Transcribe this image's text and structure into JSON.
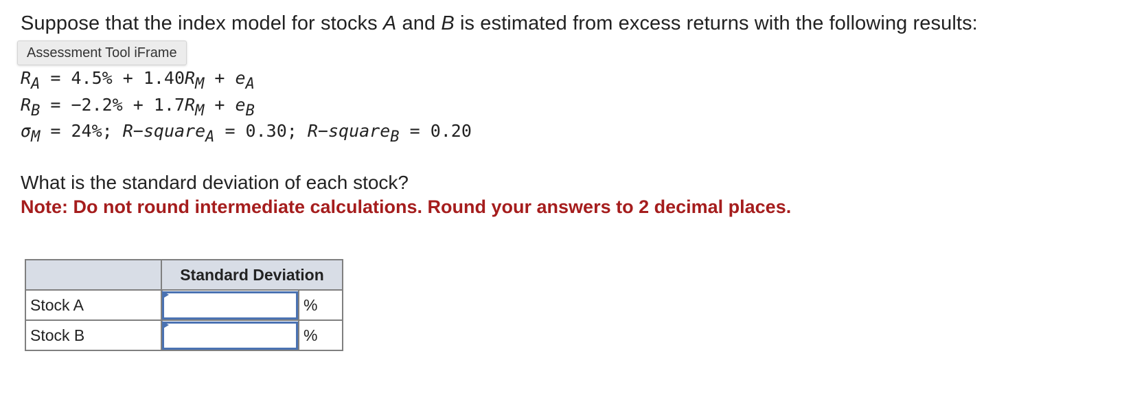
{
  "intro": {
    "before": "Suppose that the index model for stocks ",
    "stock_a": "A",
    "middle": " and ",
    "stock_b": "B",
    "after": " is estimated from excess returns with the following results:"
  },
  "tooltip": "Assessment Tool iFrame",
  "equations": {
    "line1": {
      "lhs": "R",
      "lhs_sub": "A",
      "rhs_a": " = 4.5% + 1.40",
      "rm": "R",
      "rm_sub": "M",
      "rhs_b": " + ",
      "e": "e",
      "e_sub": "A"
    },
    "line2": {
      "lhs": "R",
      "lhs_sub": "B",
      "rhs_a": " = −2.2% + 1.7",
      "rm": "R",
      "rm_sub": "M",
      "rhs_b": " + ",
      "e": "e",
      "e_sub": "B"
    },
    "line3": {
      "sigma": "σ",
      "sigma_sub": "M",
      "part1": " = 24%; ",
      "rsq_a": "R−square",
      "rsq_a_sub": "A",
      "part2": " = 0.30; ",
      "rsq_b": "R−square",
      "rsq_b_sub": "B",
      "part3": " = 0.20"
    }
  },
  "question": "What is the standard deviation of each stock?",
  "note": "Note: Do not round intermediate calculations. Round your answers to 2 decimal places.",
  "table": {
    "header": [
      "",
      "Standard Deviation"
    ],
    "rows": [
      {
        "label": "Stock A",
        "value": "",
        "unit": "%"
      },
      {
        "label": "Stock B",
        "value": "",
        "unit": "%"
      }
    ]
  },
  "colors": {
    "note_red": "#a51d1d",
    "input_border": "#4a72b2",
    "header_bg": "#d8dde6"
  }
}
